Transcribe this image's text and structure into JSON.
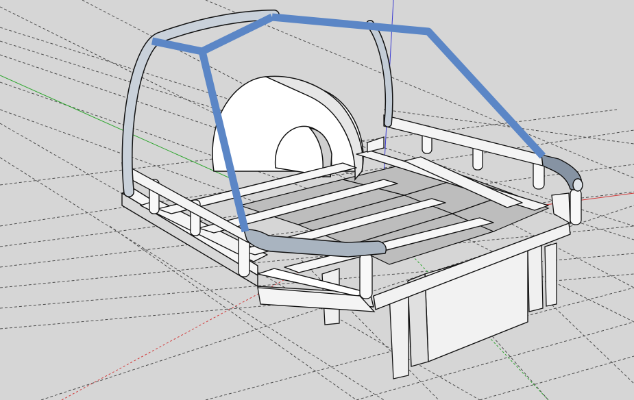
{
  "scene": {
    "description_visible_text": "",
    "colors": {
      "background": "#d6d6d6",
      "guide_line": "#4a4a4a",
      "face_light": "#ffffff",
      "face_mid": "#e4e4e4",
      "face_shade": "#c2c2c2",
      "floor_panel": "#bdbdbd",
      "edge": "#111111",
      "highlight_bar": "#5b86c6",
      "tube_dark": "#97a3b1",
      "axis_green": "#2aa52a",
      "axis_red": "#d23a3a",
      "axis_blue": "#3a3ad2"
    },
    "objects": [
      "roll-cage",
      "spare-tire",
      "chassis-frame",
      "cargo-bed",
      "storage-box",
      "axis-guides"
    ]
  }
}
